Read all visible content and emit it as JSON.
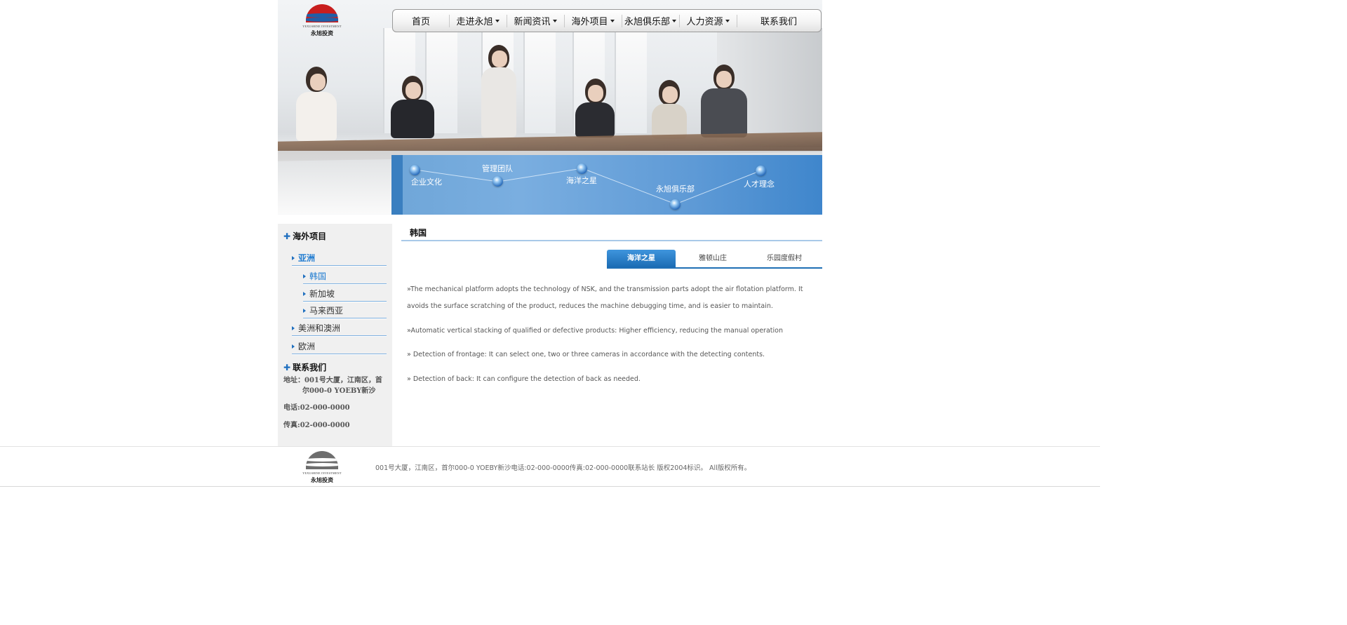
{
  "brand": {
    "name_cn": "永旭投资",
    "name_en": "YEXUSHINE INVESTMENT",
    "logo_colors": [
      "#c81e1e",
      "#1f5fa8"
    ]
  },
  "nav": {
    "items": [
      {
        "label": "首页",
        "dropdown": false
      },
      {
        "label": "走进永旭",
        "dropdown": true
      },
      {
        "label": "新闻资讯",
        "dropdown": true
      },
      {
        "label": "海外项目",
        "dropdown": true
      },
      {
        "label": "永旭俱乐部",
        "dropdown": true
      },
      {
        "label": "人力资源",
        "dropdown": true
      },
      {
        "label": "联系我们",
        "dropdown": false
      }
    ]
  },
  "band": {
    "labels": [
      "企业文化",
      "管理团队",
      "海洋之星",
      "永旭俱乐部",
      "人才理念"
    ]
  },
  "sidebar": {
    "section1_title": "海外项目",
    "asia": "亚洲",
    "asia_children": [
      "韩国",
      "新加坡",
      "马来西亚"
    ],
    "others": [
      "美洲和澳洲",
      "欧洲"
    ],
    "section2_title": "联系我们",
    "address": "地址：001号大厦，江南区，首尔000-0 YOEBY新沙",
    "phone": "电话:02-000-0000",
    "fax": "传真:02-000-0000"
  },
  "main": {
    "title": "韩国",
    "tabs": [
      "海洋之星",
      "雅顿山庄",
      "乐园度假村"
    ],
    "active_tab": "海洋之星",
    "paragraphs": [
      "»The mechanical platform adopts the technology of NSK, and the transmission parts adopt the air flotation platform. It avoids the surface scratching of the product, reduces the machine debugging time, and is easier to maintain.",
      "»Automatic vertical stacking of qualified or defective products: Higher efficiency, reducing the manual operation",
      "» Detection of frontage: It can select one, two or three cameras in accordance with the detecting contents.",
      "» Detection of back: It can configure the detection of back as needed."
    ]
  },
  "footer": {
    "text": "001号大厦，江南区，首尔000-0 YOEBY新沙电话:02-000-0000传真:02-000-0000联系站长 版权2004标识。 All版权所有。"
  },
  "colors": {
    "accent": "#1f6fbf",
    "active_link": "#1f7bd0",
    "band": "#5e9ad6"
  }
}
